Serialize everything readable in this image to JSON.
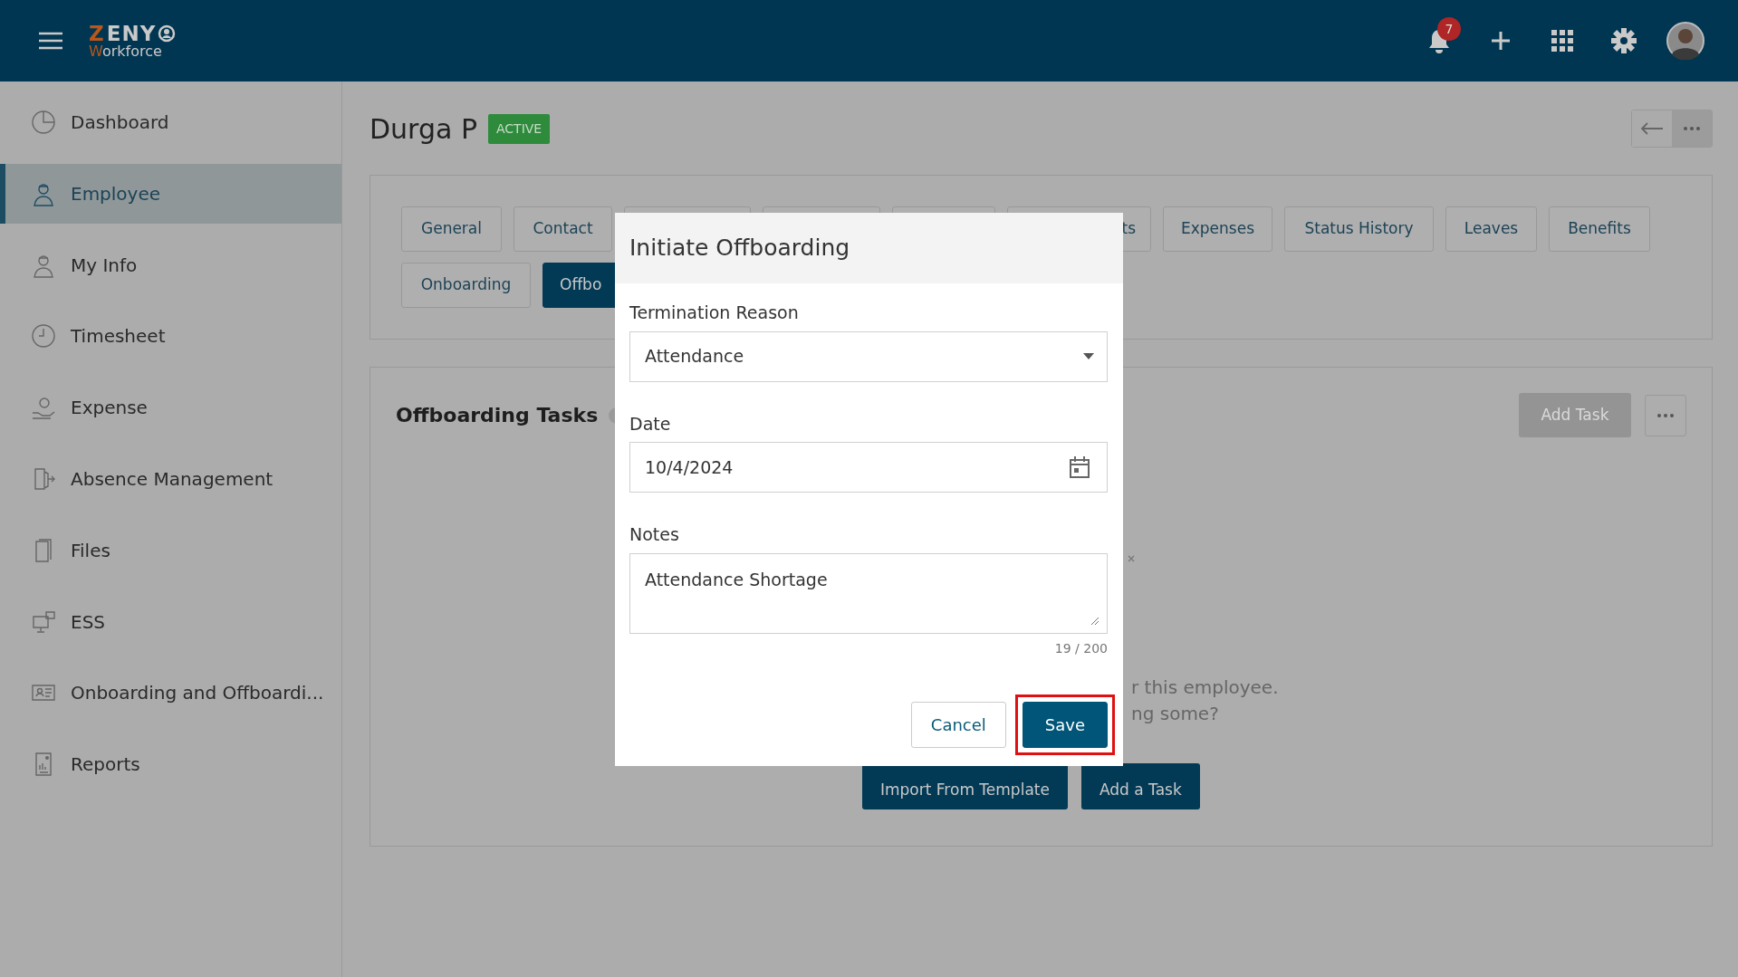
{
  "app": {
    "logo_top": "ZENY",
    "logo_bottom": "Workforce",
    "notification_count": "7"
  },
  "sidebar": {
    "items": [
      {
        "label": "Dashboard",
        "selected": false
      },
      {
        "label": "Employee",
        "selected": true
      },
      {
        "label": "My Info",
        "selected": false
      },
      {
        "label": "Timesheet",
        "selected": false
      },
      {
        "label": "Expense",
        "selected": false
      },
      {
        "label": "Absence Management",
        "selected": false
      },
      {
        "label": "Files",
        "selected": false
      },
      {
        "label": "ESS",
        "selected": false
      },
      {
        "label": "Onboarding and Offboardi...",
        "selected": false
      },
      {
        "label": "Reports",
        "selected": false
      }
    ]
  },
  "employee": {
    "name": "Durga P",
    "status": "ACTIVE"
  },
  "tabs": [
    {
      "label": "General",
      "selected": false
    },
    {
      "label": "Contact",
      "selected": false
    },
    {
      "selected": false
    },
    {
      "selected": false
    },
    {
      "selected": false
    },
    {
      "label": "ts",
      "selected": false
    },
    {
      "label": "Expenses",
      "selected": false
    },
    {
      "label": "Status History",
      "selected": false
    },
    {
      "label": "Leaves",
      "selected": false
    },
    {
      "label": "Benefits",
      "selected": false
    },
    {
      "label": "Onboarding",
      "selected": false
    },
    {
      "label": "Offbo",
      "selected": true
    }
  ],
  "tasks": {
    "title": "Offboarding Tasks",
    "add_task": {
      "label": "Add Task",
      "disabled": true
    },
    "empty_lines": [
      "r this employee.",
      "ng some?"
    ],
    "buttons": [
      "Import From Template",
      "Add a Task"
    ]
  },
  "dialog": {
    "title": "Initiate Offboarding",
    "fields": [
      {
        "label": "Termination Reason",
        "kind": "select",
        "value": "Attendance"
      },
      {
        "label": "Date",
        "kind": "date",
        "value": "10/4/2024"
      },
      {
        "label": "Notes",
        "kind": "textarea",
        "value": "Attendance Shortage",
        "counter": "19 / 200"
      }
    ],
    "buttons": [
      {
        "label": "Cancel",
        "kind": "secondary",
        "highlighted": false
      },
      {
        "label": "Save",
        "kind": "primary",
        "highlighted": true
      }
    ]
  }
}
